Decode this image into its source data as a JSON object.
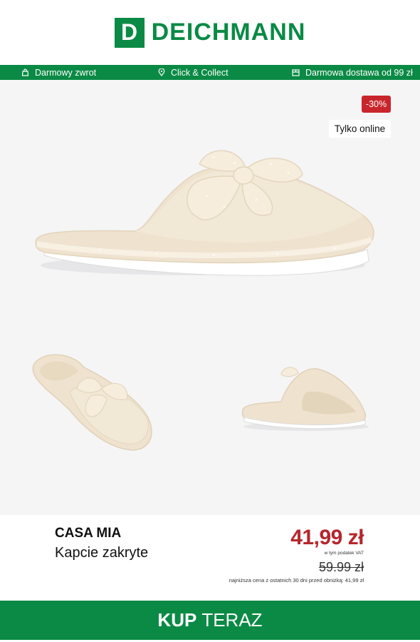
{
  "brand_logo": {
    "letter": "D",
    "name": "DEICHMANN"
  },
  "benefits": [
    {
      "label": "Darmowy zwrot",
      "icon": "return-bag-icon"
    },
    {
      "label": "Click & Collect",
      "icon": "location-pin-icon"
    },
    {
      "label": "Darmowa dostawa od 99 zł",
      "icon": "delivery-box-icon"
    }
  ],
  "badges": {
    "discount": "-30%",
    "online": "Tylko online"
  },
  "product": {
    "brand": "CASA MIA",
    "name": "Kapcie zakryte",
    "price": "41,99 zł",
    "vat_note": "w tym podatek VAT",
    "old_price": "59.99 zł",
    "lowest_price_note": "najniższa cena z ostatnich 30 dni przed obniżką: 41,99 zł"
  },
  "cta": {
    "bold": "KUP",
    "rest": "TERAZ"
  },
  "colors": {
    "brand_green": "#0a8a45",
    "sale_red": "#c8262c",
    "price_red": "#b6262d",
    "gallery_bg": "#f5f5f6",
    "slipper": "#efe3cf"
  }
}
